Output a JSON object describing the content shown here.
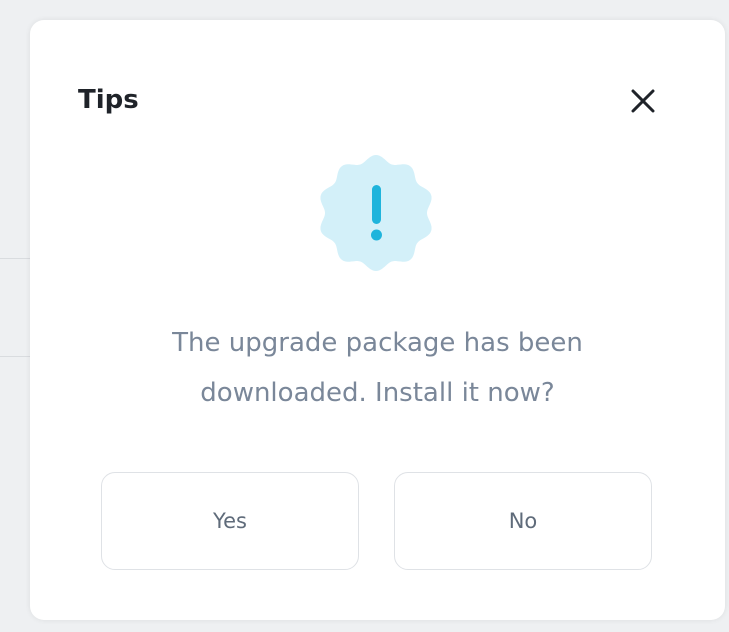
{
  "dialog": {
    "title": "Tips",
    "close_icon": "close-icon",
    "status_icon": "exclamation-badge-icon",
    "message_line1": "The upgrade package has been",
    "message_line2": "downloaded. Install it now?",
    "yes_label": "Yes",
    "no_label": "No"
  },
  "colors": {
    "accent": "#1fb4dc",
    "badge_fill": "#d3f0f9",
    "title_text": "#1f2329",
    "message_text": "#7a8799",
    "button_border": "#dfe2e6"
  }
}
